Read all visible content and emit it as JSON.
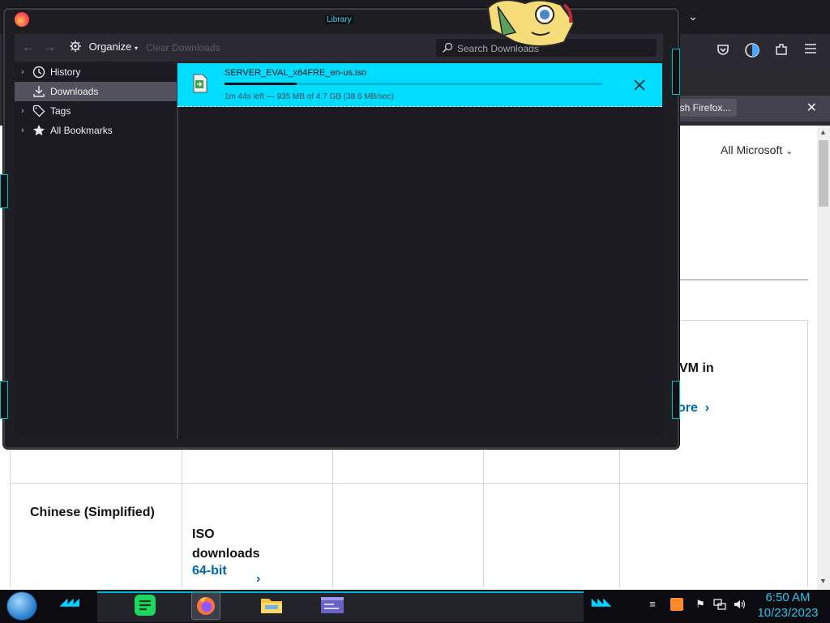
{
  "library_window": {
    "title": "Library",
    "toolbar": {
      "organize_label": "Organize",
      "organize_caret": "▾",
      "clear_downloads_label": "Clear Downloads",
      "search_placeholder": "Search Downloads"
    },
    "sidebar": {
      "items": [
        {
          "label": "History",
          "icon": "clock-icon",
          "twisty": "›",
          "selected": false
        },
        {
          "label": "Downloads",
          "icon": "download-icon",
          "twisty": "",
          "selected": true
        },
        {
          "label": "Tags",
          "icon": "tag-icon",
          "twisty": "›",
          "selected": false
        },
        {
          "label": "All Bookmarks",
          "icon": "star-icon",
          "twisty": "›",
          "selected": false
        }
      ]
    },
    "downloads": [
      {
        "filename": "SERVER_EVAL_x64FRE_en-us.iso",
        "status": "1m 44s left — 935 MB of 4.7 GB (38.6 MB/sec)",
        "progress": 0.19
      }
    ]
  },
  "background_browser": {
    "notification_button": "esh Firefox...",
    "nav_dropdown": "All Microsoft",
    "card_text": "VM in",
    "card_link": "ore",
    "language_label": "Chinese (Simplified)",
    "iso_line1": "ISO",
    "iso_line2": "downloads",
    "bit_link": "64-bit"
  },
  "taskbar": {
    "time": "6:50 AM",
    "date": "10/23/2023"
  },
  "colors": {
    "download_highlight": "#00ddff",
    "accent_cyan": "#00c8f0",
    "link_blue": "#0067b8"
  }
}
